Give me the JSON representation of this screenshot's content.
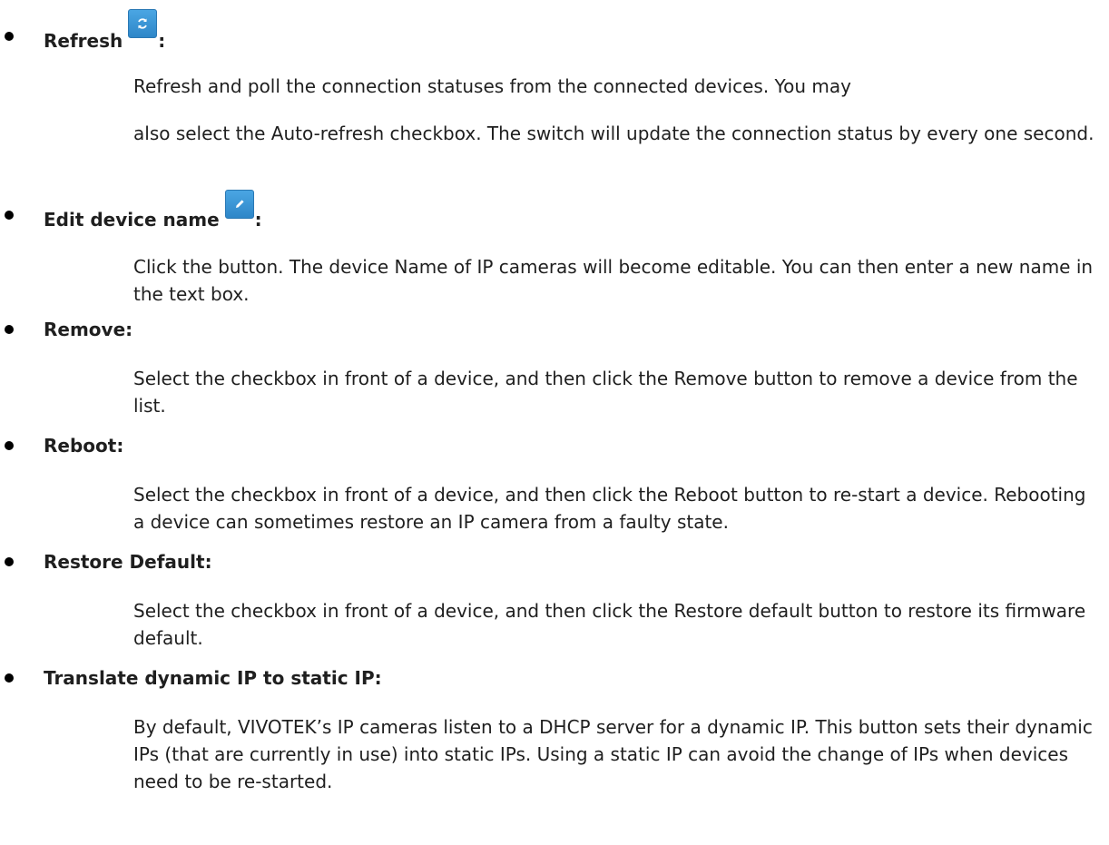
{
  "items": [
    {
      "title": "Refresh",
      "icon": "refresh-icon",
      "paragraphs": [
        "Refresh and poll the connection statuses from the connected devices. You may",
        "also select the Auto-refresh checkbox. The switch will update the connection status by every one second."
      ]
    },
    {
      "title": "Edit device name",
      "icon": "pencil-icon",
      "paragraphs": [
        "Click the button. The device Name of IP cameras will become editable. You can then enter a new name in the text box."
      ]
    },
    {
      "title": "Remove:",
      "paragraphs": [
        "Select the checkbox in front of a device, and then click the Remove button to remove a device from the list."
      ]
    },
    {
      "title": "Reboot:",
      "paragraphs": [
        "Select the checkbox in front of a device, and then click the Reboot button to re-start a device. Rebooting a device can sometimes restore an IP camera from a faulty state."
      ]
    },
    {
      "title": "Restore Default:",
      "paragraphs": [
        "Select the checkbox in front of a device, and then click the Restore default button to restore its firmware default."
      ]
    },
    {
      "title": "Translate dynamic IP to static IP:",
      "paragraphs": [
        "By default, VIVOTEK’s IP cameras listen to a DHCP server for a dynamic IP. This button sets their dynamic IPs (that are currently in use) into static IPs. Using a static IP can avoid the change of IPs when devices need to be re-started."
      ]
    }
  ],
  "colors": {
    "button": "#3a95d6",
    "text": "#1f1f1f",
    "bullet": "#000000"
  }
}
